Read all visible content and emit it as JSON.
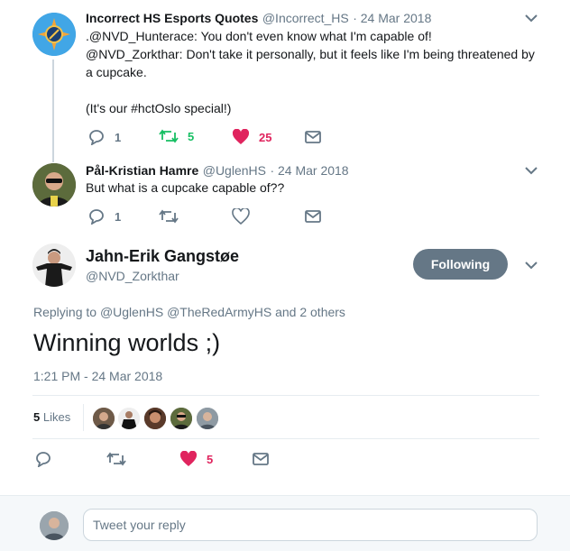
{
  "tweet1": {
    "name": "Incorrect HS Esports Quotes",
    "handle": "@Incorrect_HS",
    "date": "· 24 Mar 2018",
    "lines": [
      ".@NVD_Hunterace: You don't even know what I'm capable of!",
      "@NVD_Zorkthar: Don't take it personally, but it feels like I'm being threatened by",
      "a cupcake.",
      "",
      "(It's our #hctOslo special!)"
    ],
    "replies": "1",
    "retweets": "5",
    "likes": "25"
  },
  "tweet2": {
    "name": "Pål-Kristian Hamre",
    "handle": "@UglenHS",
    "date": "· 24 Mar 2018",
    "text": "But what is a cupcake capable of??",
    "replies": "1"
  },
  "main": {
    "name": "Jahn-Erik Gangstøe",
    "handle": "@NVD_Zorkthar",
    "follow_label": "Following",
    "replying_prefix": "Replying to",
    "replying_to": "@UglenHS @TheRedArmyHS",
    "replying_suffix": "and 2 others",
    "text": "Winning worlds ;)",
    "timestamp": "1:21 PM - 24 Mar 2018",
    "likes_count": "5",
    "likes_label": "Likes",
    "like_action_count": "5"
  },
  "reply": {
    "placeholder": "Tweet your reply"
  },
  "colors": {
    "accent": "#1da1f2",
    "retweet": "#17bf63",
    "like": "#e0245e",
    "muted": "#657786"
  },
  "icons": [
    "reply-icon",
    "retweet-icon",
    "heart-icon",
    "mail-icon",
    "chevron-down-icon"
  ]
}
